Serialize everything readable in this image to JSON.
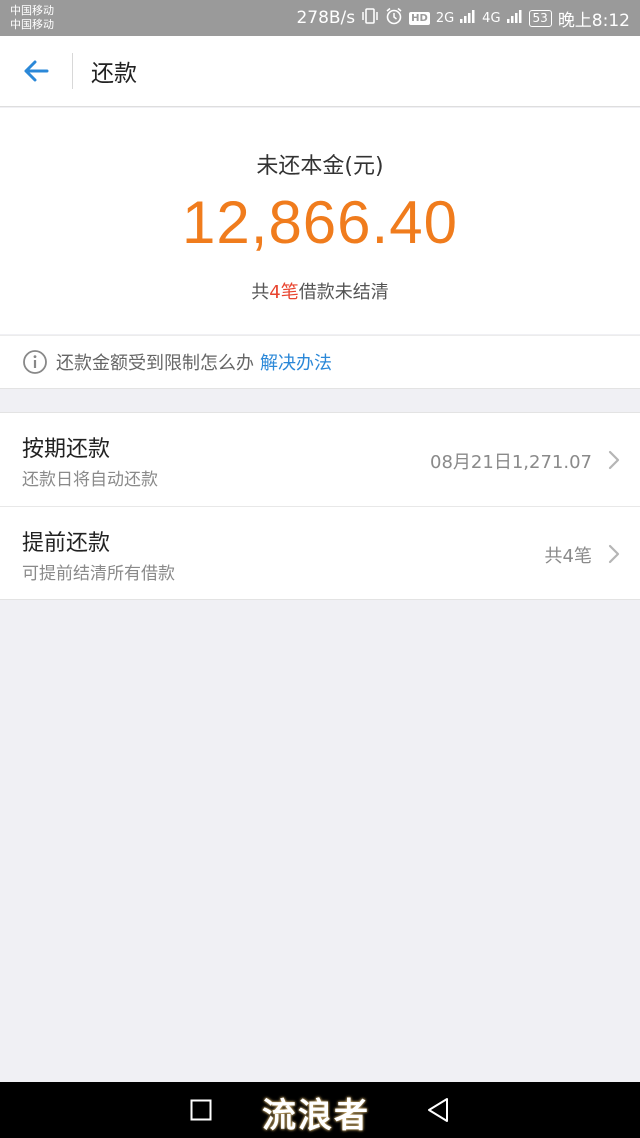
{
  "status_bar": {
    "carrier_1": "中国移动",
    "carrier_2": "中国移动",
    "net_speed": "278B/s",
    "signal_1": "2G",
    "signal_2": "4G",
    "battery": "53",
    "time": "晚上8:12"
  },
  "header": {
    "title": "还款"
  },
  "summary": {
    "label": "未还本金(元)",
    "amount": "12,866.40",
    "count_prefix": "共",
    "count_num": "4笔",
    "count_suffix": "借款未结清"
  },
  "notice": {
    "text": "还款金额受到限制怎么办",
    "link": "解决办法"
  },
  "rows": [
    {
      "title": "按期还款",
      "subtitle": "还款日将自动还款",
      "value": "08月21日1,271.07"
    },
    {
      "title": "提前还款",
      "subtitle": "可提前结清所有借款",
      "value": "共4笔"
    }
  ],
  "watermark": "流浪者",
  "colors": {
    "accent_orange": "#f07c1d",
    "accent_red": "#e8442f",
    "link_blue": "#2b88d8"
  }
}
